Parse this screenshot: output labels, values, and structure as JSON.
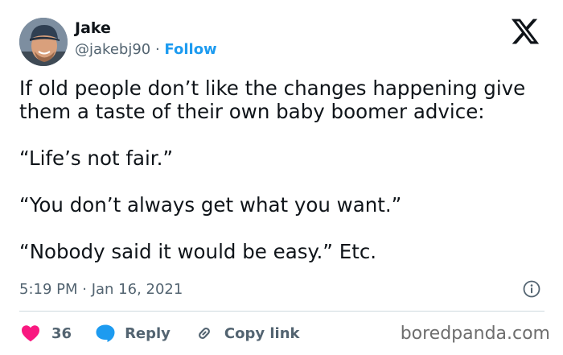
{
  "author": {
    "name": "Jake",
    "handle": "@jakebj90",
    "separator": "·",
    "follow_label": "Follow"
  },
  "tweet": {
    "lines": [
      "If old people don’t like the changes happening give",
      "them a taste of their own baby boomer advice:",
      "“Life’s not fair.”",
      "“You don’t always get what you want.”",
      "“Nobody said it would be easy.” Etc."
    ],
    "time": "5:19 PM · Jan 16, 2021"
  },
  "actions": {
    "like_count": "36",
    "reply_label": "Reply",
    "copy_link_label": "Copy link"
  },
  "watermark": "boredpanda.com",
  "colors": {
    "accent": "#1d9bf0",
    "like": "#f91880",
    "muted": "#536471",
    "text": "#0f1419"
  },
  "icons": [
    "x-logo-icon",
    "info-icon",
    "heart-icon",
    "reply-bubble-icon",
    "link-icon"
  ]
}
